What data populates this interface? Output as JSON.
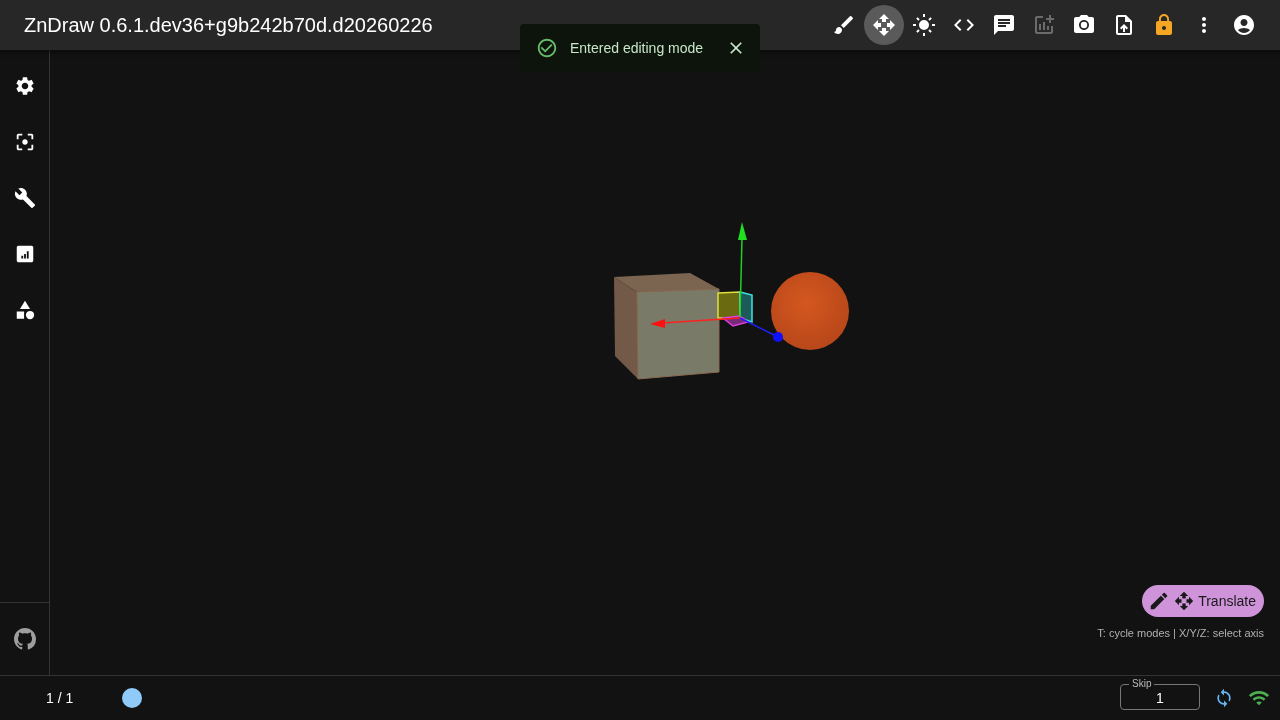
{
  "app": {
    "title": "ZnDraw 0.6.1.dev36+g9b242b70d.d20260226"
  },
  "toolbar": [
    {
      "selected": false,
      "disabled": false
    },
    {
      "selected": true,
      "disabled": false
    },
    {
      "selected": false,
      "disabled": false
    },
    {
      "selected": false,
      "disabled": false
    },
    {
      "selected": false,
      "disabled": false
    },
    {
      "selected": false,
      "disabled": true
    },
    {
      "selected": false,
      "disabled": false
    },
    {
      "selected": false,
      "disabled": false
    },
    {
      "selected": false,
      "disabled": false
    },
    {
      "selected": false,
      "disabled": false
    },
    {
      "selected": false,
      "disabled": false
    }
  ],
  "toast": {
    "message": "Entered editing mode"
  },
  "editor": {
    "mode": "Translate",
    "hint": "T: cycle modes | X/Y/Z: select axis"
  },
  "bottom_bar": {
    "frame": "1 / 1",
    "skip": {
      "label": "Skip",
      "value": "1"
    }
  }
}
